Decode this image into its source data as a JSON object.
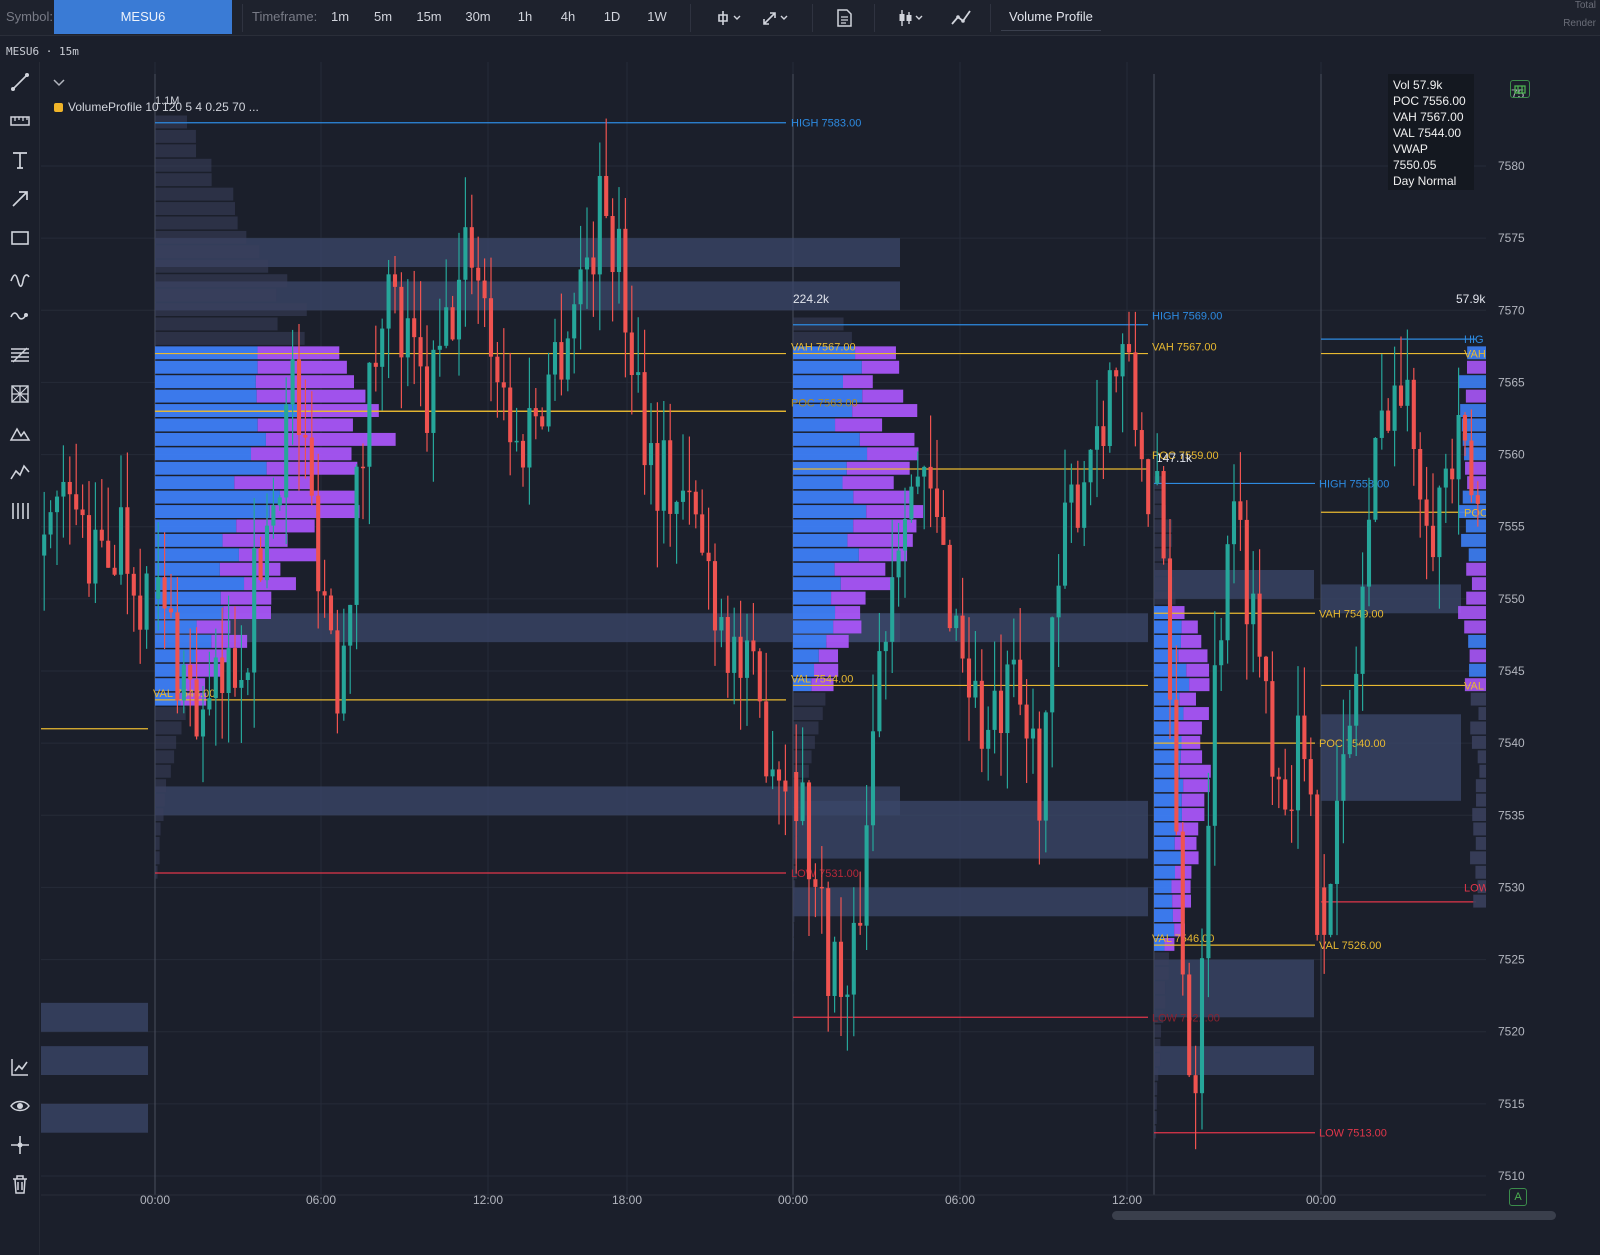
{
  "toolbar": {
    "symbol_label": "Symbol:",
    "symbol_value": "MESU6",
    "timeframe_label": "Timeframe:",
    "timeframes": [
      "1m",
      "5m",
      "15m",
      "30m",
      "1h",
      "4h",
      "1D",
      "1W"
    ],
    "volume_profile_label": "Volume Profile",
    "corner_total": "Total",
    "corner_render": "Render"
  },
  "chart_info": {
    "symbol_interval": "MESU6 · 15m",
    "legend_text": "VolumeProfile 10 120 5 4 0.25 70 ..."
  },
  "stats_box": {
    "vol": "Vol 57.9k",
    "poc": "POC 7556.00",
    "vah": "VAH 7567.00",
    "val": "VAL 7544.00",
    "vwap": "VWAP 7550.05",
    "day": "Day Normal"
  },
  "colors": {
    "background": "#1b1f2b",
    "up_candle": "#26a69a",
    "down_candle": "#ef5350",
    "value_area_line": "#e8b931",
    "high_line": "#2d8ae0",
    "low_line": "#e0364a",
    "profile_blue": "#3d7ef5",
    "profile_purple": "#a855f7",
    "zone": "#3a4668"
  },
  "chart_data": {
    "type": "candlestick",
    "ylim": [
      7509,
      7586
    ],
    "y_ticks": [
      "7580",
      "7575",
      "7570",
      "7565",
      "7560",
      "7555",
      "7550",
      "7545",
      "7540",
      "7535",
      "7530",
      "7525",
      "7520",
      "7515",
      "7510"
    ],
    "x_ticks": [
      "00:00",
      "06:00",
      "12:00",
      "18:00",
      "00:00",
      "06:00",
      "12:00",
      "00:00"
    ],
    "sessions": [
      {
        "total_volume_label": "1.1M",
        "high": 7583.0,
        "low": 7531.0,
        "poc": 7563.0,
        "vah": 7567.0,
        "val": 7543.0,
        "high_label": "HIGH 7583.00",
        "val_label": "VAL 7543.00"
      },
      {
        "total_volume_label": "224.2k",
        "high": 7569.0,
        "low": 7521.0,
        "poc": 7559.0,
        "vah": 7567.0,
        "val": 7544.0,
        "high_label": "HIGH 7569.00",
        "vah_label": "VAH 7567.00",
        "poc_label": "POC 7563.00",
        "val_label": "VAL 7544.00",
        "low_label": "LOW 7531.00",
        "vah_right_label": "VAH 7567.00",
        "poc_right_label": "POC 7559.00"
      },
      {
        "total_volume_label": "147.1k",
        "high": 7558.0,
        "low": 7513.0,
        "poc": 7540.0,
        "vah": 7549.0,
        "val": 7526.0,
        "high_label": "HIGH 7558.00",
        "val_label": "VAL 7546.00",
        "low_label": "LOW 7521.00",
        "vah_right_label": "VAH 7549.00",
        "poc_right_label": "POC 7540.00",
        "val_right_label": "VAL 7526.00",
        "low_right_label": "LOW 7513.00"
      },
      {
        "total_volume_label": "57.9k",
        "high": 7568.0,
        "low": 7529.0,
        "poc": 7556.0,
        "vah": 7567.0,
        "val": 7544.0,
        "high_label": "HIG",
        "vah_label": "VAH",
        "poc_label": "POC",
        "val_label": "VAL",
        "low_label": "LOW"
      }
    ]
  }
}
